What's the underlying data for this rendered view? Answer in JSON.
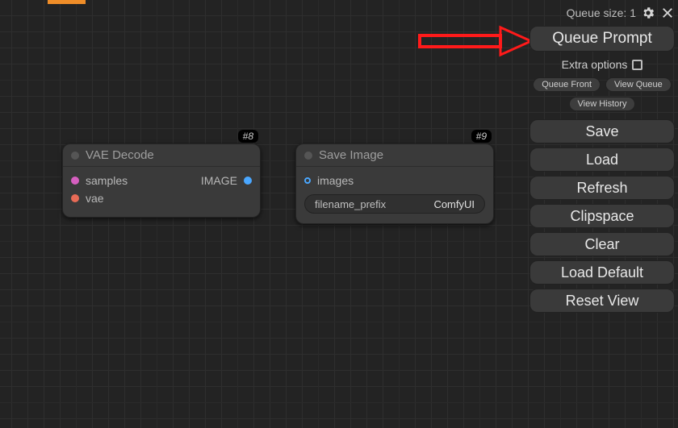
{
  "queue_status": "Queue size: 1",
  "nodes": {
    "n8": {
      "badge": "#8",
      "title": "VAE Decode",
      "inputs": {
        "samples": "samples",
        "vae": "vae"
      },
      "outputs": {
        "image": "IMAGE"
      }
    },
    "n9": {
      "badge": "#9",
      "title": "Save Image",
      "inputs": {
        "images": "images"
      },
      "widget": {
        "label": "filename_prefix",
        "value": "ComfyUI"
      }
    }
  },
  "panel": {
    "queue_prompt": "Queue Prompt",
    "extra_options": "Extra options",
    "queue_front": "Queue Front",
    "view_queue": "View Queue",
    "view_history": "View History",
    "save": "Save",
    "load": "Load",
    "refresh": "Refresh",
    "clipspace": "Clipspace",
    "clear": "Clear",
    "load_default": "Load Default",
    "reset_view": "Reset View"
  },
  "colors": {
    "samples_port": "#d65fc0",
    "vae_port": "#e86b56",
    "image_port": "#4aa7ff",
    "images_port": "#4aa7ff",
    "arrow": "#ff1a1a"
  }
}
